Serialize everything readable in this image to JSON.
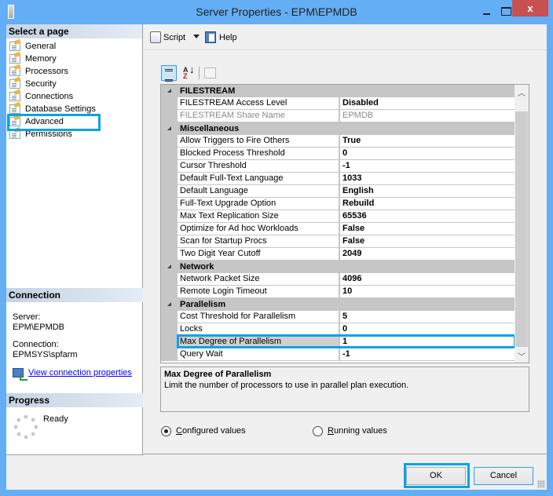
{
  "window": {
    "title": "Server Properties - EPM\\EPMDB",
    "minimize_label": "minimize",
    "maximize_label": "maximize",
    "close_glyph": "x"
  },
  "left": {
    "select_header": "Select a page",
    "pages": [
      {
        "label": "General",
        "icon": "page-icon"
      },
      {
        "label": "Memory",
        "icon": "page-icon"
      },
      {
        "label": "Processors",
        "icon": "page-icon"
      },
      {
        "label": "Security",
        "icon": "page-icon"
      },
      {
        "label": "Connections",
        "icon": "page-icon"
      },
      {
        "label": "Database Settings",
        "icon": "page-icon"
      },
      {
        "label": "Advanced",
        "icon": "page-icon",
        "selected": true
      },
      {
        "label": "Permissions",
        "icon": "page-icon"
      }
    ],
    "connection": {
      "header": "Connection",
      "server_label": "Server:",
      "server_value": "EPM\\EPMDB",
      "connection_label": "Connection:",
      "connection_value": "EPMSYS\\spfarm",
      "view_link": "View connection properties"
    },
    "progress": {
      "header": "Progress",
      "status": "Ready"
    }
  },
  "toolbar": {
    "script_label": "Script",
    "help_label": "Help"
  },
  "grid": {
    "categories": [
      {
        "name": "FILESTREAM",
        "props": [
          {
            "name": "FILESTREAM Access Level",
            "value": "Disabled"
          },
          {
            "name": "FILESTREAM Share Name",
            "value": "EPMDB",
            "readonly": true
          }
        ]
      },
      {
        "name": "Miscellaneous",
        "props": [
          {
            "name": "Allow Triggers to Fire Others",
            "value": "True"
          },
          {
            "name": "Blocked Process Threshold",
            "value": "0"
          },
          {
            "name": "Cursor Threshold",
            "value": "-1"
          },
          {
            "name": "Default Full-Text Language",
            "value": "1033"
          },
          {
            "name": "Default Language",
            "value": "English"
          },
          {
            "name": "Full-Text Upgrade Option",
            "value": "Rebuild"
          },
          {
            "name": "Max Text Replication Size",
            "value": "65536"
          },
          {
            "name": "Optimize for Ad hoc Workloads",
            "value": "False"
          },
          {
            "name": "Scan for Startup Procs",
            "value": "False"
          },
          {
            "name": "Two Digit Year Cutoff",
            "value": "2049"
          }
        ]
      },
      {
        "name": "Network",
        "props": [
          {
            "name": "Network Packet Size",
            "value": "4096"
          },
          {
            "name": "Remote Login Timeout",
            "value": "10"
          }
        ]
      },
      {
        "name": "Parallelism",
        "props": [
          {
            "name": "Cost Threshold for Parallelism",
            "value": "5"
          },
          {
            "name": "Locks",
            "value": "0"
          },
          {
            "name": "Max Degree of Parallelism",
            "value": "1",
            "selected": true
          },
          {
            "name": "Query Wait",
            "value": "-1"
          }
        ]
      }
    ]
  },
  "description": {
    "title": "Max Degree of Parallelism",
    "text": "Limit the number of processors to use in parallel plan execution."
  },
  "radios": {
    "configured": {
      "first": "C",
      "rest": "onfigured values",
      "checked": true
    },
    "running": {
      "first": "R",
      "rest": "unning values",
      "checked": false
    }
  },
  "buttons": {
    "ok": "OK",
    "cancel": "Cancel"
  },
  "colors": {
    "highlight": "#0aa3e6",
    "titlebar": "#63aef4",
    "close": "#c75050"
  }
}
